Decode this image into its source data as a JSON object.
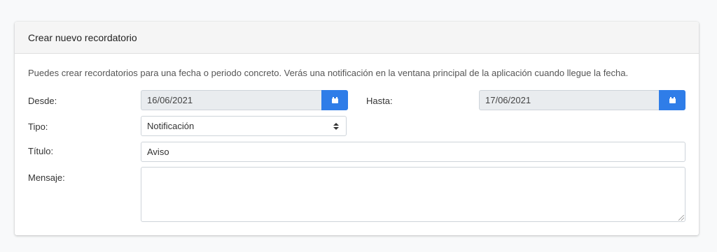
{
  "card": {
    "title": "Crear nuevo recordatorio",
    "description": "Puedes crear recordatorios para una fecha o periodo concreto. Verás una notificación en la ventana principal de la aplicación cuando llegue la fecha."
  },
  "form": {
    "desde": {
      "label": "Desde:",
      "value": "16/06/2021"
    },
    "hasta": {
      "label": "Hasta:",
      "value": "17/06/2021"
    },
    "tipo": {
      "label": "Tipo:",
      "value": "Notificación"
    },
    "titulo": {
      "label": "Título:",
      "value": "Aviso"
    },
    "mensaje": {
      "label": "Mensaje:",
      "value": ""
    }
  },
  "colors": {
    "accent": "#2f7de8",
    "readonly_bg": "#e9ecef"
  },
  "icons": {
    "calendar": "calendar-icon",
    "select": "select-arrows-icon",
    "resize": "resize-handle-icon"
  }
}
